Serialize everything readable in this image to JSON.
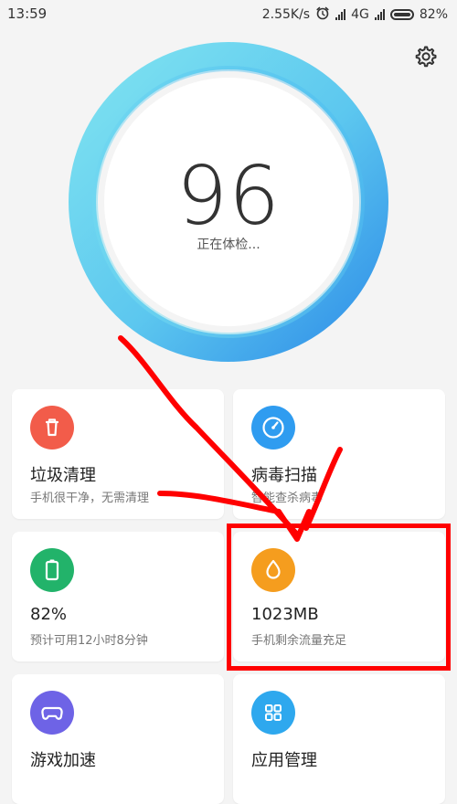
{
  "status_bar": {
    "time": "13:59",
    "network_speed": "2.55K/s",
    "network_type": "4G",
    "battery_percent": "82%",
    "icons": [
      "alarm-icon",
      "signal-icon",
      "signal-icon-2",
      "battery-icon"
    ]
  },
  "score": {
    "value": "96",
    "status": "正在体检..."
  },
  "cards": [
    {
      "title": "垃圾清理",
      "subtitle": "手机很干净，无需清理",
      "icon": "trash-icon",
      "color": "#f25c4a"
    },
    {
      "title": "病毒扫描",
      "subtitle": "智能查杀病毒",
      "icon": "speedometer-icon",
      "color": "#2f9cf0"
    },
    {
      "title": "82%",
      "subtitle": "预计可用12小时8分钟",
      "icon": "battery-icon",
      "color": "#22b36a"
    },
    {
      "title": "1023MB",
      "subtitle": "手机剩余流量充足",
      "icon": "water-drop-icon",
      "color": "#f59d1e"
    },
    {
      "title": "游戏加速",
      "subtitle": "",
      "icon": "gamepad-icon",
      "color": "#6e63e6"
    },
    {
      "title": "应用管理",
      "subtitle": "",
      "icon": "grid-icon",
      "color": "#2ea8ee"
    }
  ],
  "colors": {
    "ring_light": "#7fe3f0",
    "ring_dark": "#2f8ee8",
    "highlight_red": "#ff0000"
  }
}
